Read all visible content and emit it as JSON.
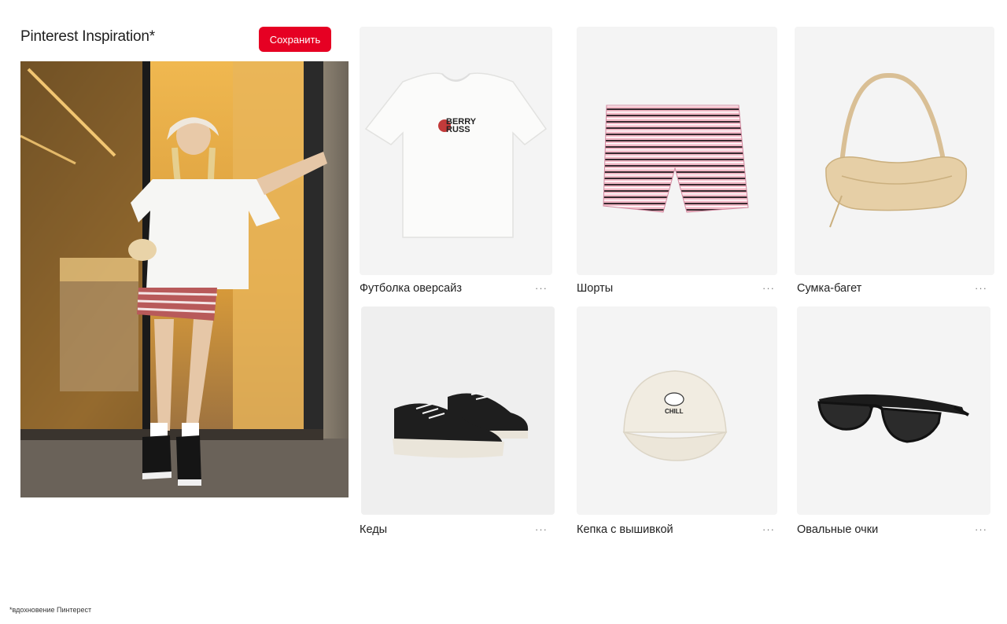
{
  "header": {
    "title": "Pinterest Inspiration*",
    "save_label": "Сохранить"
  },
  "colors": {
    "accent": "#e60023",
    "card_bg": "#f4f4f4"
  },
  "products": [
    {
      "label": "Футболка оверсайз",
      "more": "···",
      "icon": "t-shirt-image",
      "print_text": [
        "BERRY",
        "RUSS"
      ]
    },
    {
      "label": "Шорты",
      "more": "···",
      "icon": "striped-shorts-image"
    },
    {
      "label": "Сумка-багет",
      "more": "···",
      "icon": "baguette-bag-image"
    },
    {
      "label": "Кеды",
      "more": "···",
      "icon": "sneakers-image"
    },
    {
      "label": "Кепка с вышивкой",
      "more": "···",
      "icon": "embroidered-cap-image",
      "print_text": "CHILL"
    },
    {
      "label": "Овальные очки",
      "more": "···",
      "icon": "oval-sunglasses-image"
    }
  ],
  "footnote": "*вдохновение Пинтерест"
}
